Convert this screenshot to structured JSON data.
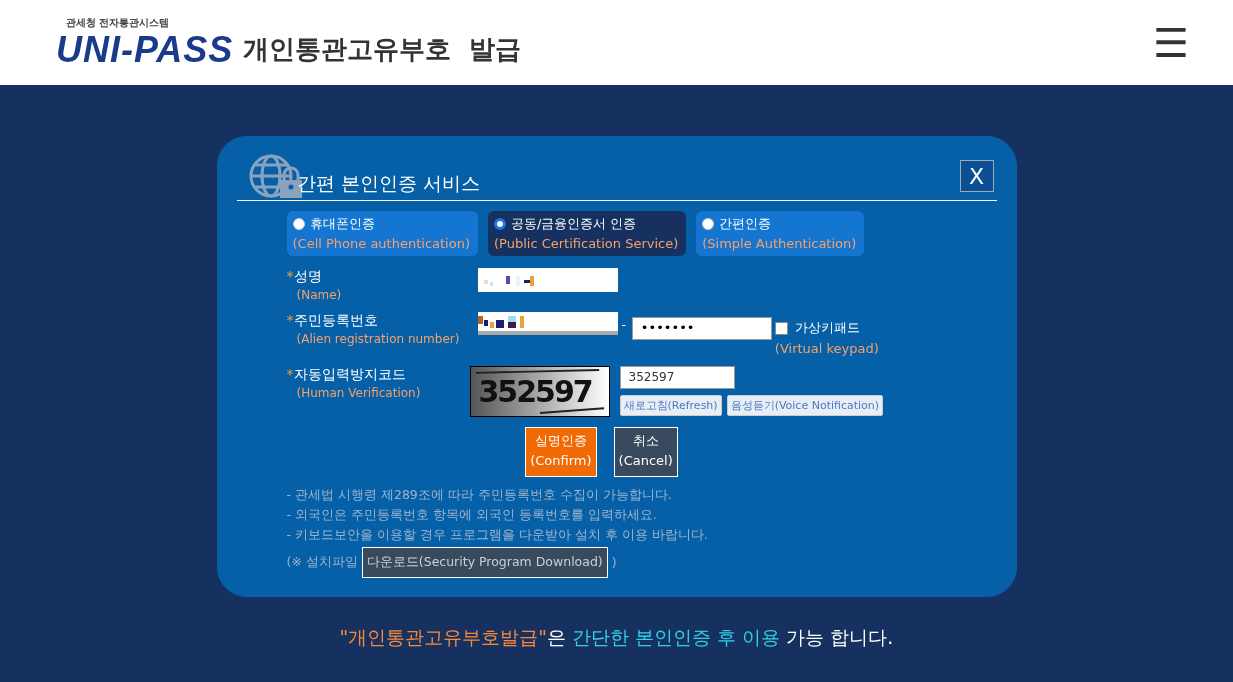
{
  "header": {
    "logo_caption": "관세청 전자통관시스템",
    "logo_text": "UNI-PASS",
    "title": "개인통관고유부호  발급",
    "menu_icon": "☰"
  },
  "dialog": {
    "title": "간편 본인인증 서비스",
    "close": "X",
    "tabs": [
      {
        "label": "휴대폰인증",
        "sublabel": "(Cell Phone authentication)",
        "selected": false
      },
      {
        "label": "공동/금융인증서 인증",
        "sublabel": "(Public Certification Service)",
        "selected": true
      },
      {
        "label": "간편인증",
        "sublabel": "(Simple Authentication)",
        "selected": false
      }
    ],
    "fields": [
      {
        "kind": "name",
        "required": "*",
        "label": "성명",
        "sublabel": "(Name)"
      },
      {
        "kind": "registration",
        "required": "*",
        "label": "주민등록번호",
        "sublabel": "(Alien registration number)",
        "separator": "-",
        "password_value": "•••••••",
        "keypad_label": "가상키패드",
        "keypad_sublabel": "(Virtual keypad)",
        "keypad_checked": false
      },
      {
        "kind": "captcha",
        "required": "*",
        "label": "자동입력방지코드",
        "sublabel": "(Human Verification)",
        "captcha_text": "352597",
        "value": "352597",
        "buttons": [
          "새로고침(Refresh)",
          "음성듣기(Voice Notification)"
        ]
      }
    ],
    "actions": [
      {
        "kind": "primary",
        "label": "실명인증",
        "sublabel": "(Confirm)"
      },
      {
        "kind": "secondary",
        "label": "취소",
        "sublabel": "(Cancel)"
      }
    ],
    "notes": [
      "- 관세법 시행령 제289조에 따라 주민등록번호 수집이 가능합니다.",
      "- 외국인은 주민등록번호 항목에 외국인 등록번호를 입력하세요.",
      "- 키보드보안을 이용할 경우 프로그램을 다운받아 설치 후 이용 바랍니다."
    ],
    "download": {
      "prefix": "(※ 설치파일",
      "button": "다운로드(Security Program Download)",
      "suffix": ")"
    }
  },
  "notice": [
    {
      "text": "\"개인통관고유부호발급\"",
      "color": "#f7893b"
    },
    {
      "text": "은 ",
      "color": "#ffffff"
    },
    {
      "text": "간단한 본인인증 후 이용",
      "color": "#30d0e8"
    },
    {
      "text": " 가능 합니다.",
      "color": "#ffffff"
    }
  ]
}
